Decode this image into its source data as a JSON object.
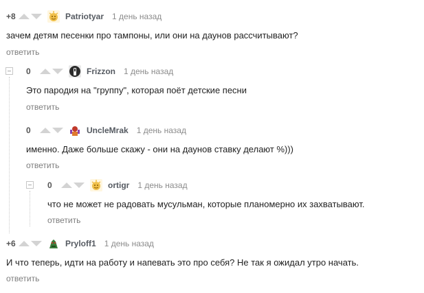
{
  "colors": {
    "arrow": "#d3d3d3",
    "username": "#555a61",
    "time": "#8b8b8b",
    "reply": "#7d7d7d",
    "text": "#222222"
  },
  "comments": [
    {
      "rating": "+8",
      "username": "Patriotyar",
      "time": "1 день назад",
      "text": "зачем детям песенки про тампоны, или они на даунов рассчитывают?",
      "reply": "ответить",
      "avatar_icon": "golden-sun-avatar-icon"
    },
    {
      "rating": "0",
      "username": "Frizzon",
      "time": "1 день назад",
      "text": "Это пародия на \"группу\", которая поёт детские песни",
      "reply": "ответить",
      "avatar_icon": "dark-figure-avatar-icon"
    },
    {
      "rating": "0",
      "username": "UncleMrak",
      "time": "1 день назад",
      "text": "именно. Даже больше скажу - они на даунов ставку делают %)))",
      "reply": "ответить",
      "avatar_icon": "red-character-avatar-icon"
    },
    {
      "rating": "0",
      "username": "ortigr",
      "time": "1 день назад",
      "text": "что не может не радовать мусульман, которые планомерно их захватывают.",
      "reply": "ответить",
      "avatar_icon": "golden-sun-avatar-icon"
    },
    {
      "rating": "+6",
      "username": "Pryloff1",
      "time": "1 день назад",
      "text": "И что теперь, идти на работу и напевать это про себя? Не так я ожидал утро начать.",
      "reply": "ответить",
      "avatar_icon": "green-creature-avatar-icon"
    }
  ]
}
